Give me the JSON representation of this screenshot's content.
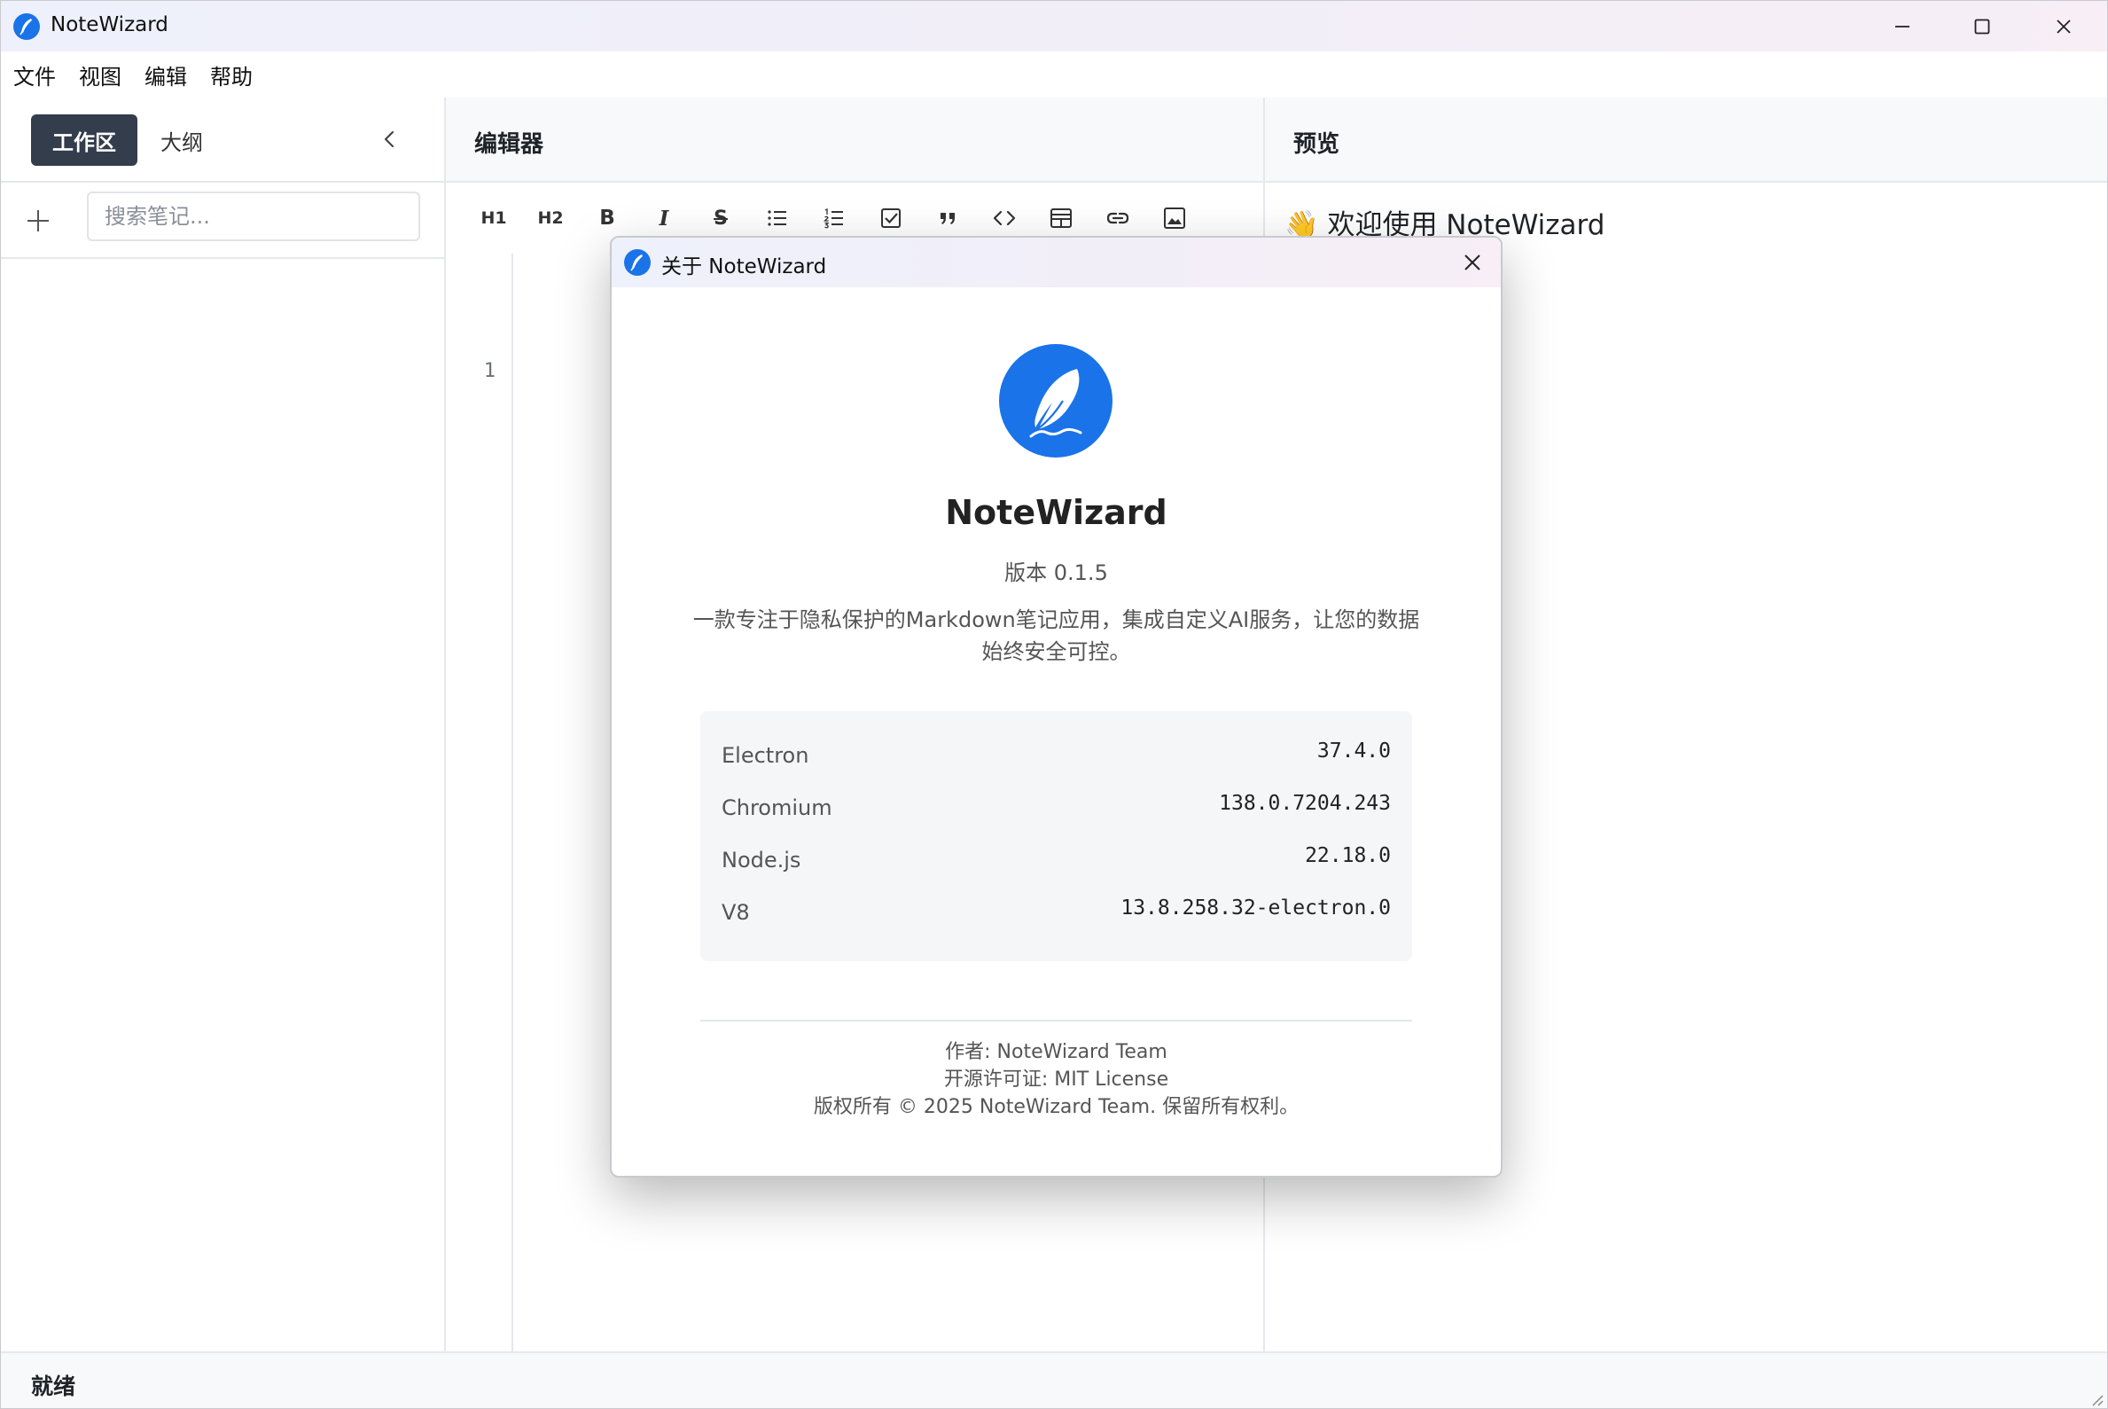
{
  "window": {
    "title": "NoteWizard",
    "controls": {
      "minimize_icon": "minimize-icon",
      "maximize_icon": "maximize-icon",
      "close_icon": "close-icon"
    }
  },
  "menu": {
    "items": [
      "文件",
      "视图",
      "编辑",
      "帮助"
    ]
  },
  "sidebar": {
    "tabs": [
      {
        "label": "工作区",
        "active": true
      },
      {
        "label": "大纲",
        "active": false
      }
    ],
    "search_placeholder": "搜索笔记..."
  },
  "editor": {
    "title": "编辑器",
    "toolbar": [
      "H1",
      "H2",
      "B",
      "I",
      "S",
      "bullet-list-icon",
      "ordered-list-icon",
      "checkbox-icon",
      "quote-icon",
      "code-icon",
      "table-icon",
      "link-icon",
      "image-icon"
    ],
    "line_numbers": [
      "1"
    ]
  },
  "preview": {
    "title": "预览",
    "heading": "👋 欢迎使用 NoteWizard"
  },
  "status": {
    "text": "就绪"
  },
  "about_dialog": {
    "title": "关于 NoteWizard",
    "app_name": "NoteWizard",
    "version": "版本 0.1.5",
    "description": "一款专注于隐私保护的Markdown笔记应用，集成自定义AI服务，让您的数据始终安全可控。",
    "versions": [
      {
        "label": "Electron",
        "value": "37.4.0"
      },
      {
        "label": "Chromium",
        "value": "138.0.7204.243"
      },
      {
        "label": "Node.js",
        "value": "22.18.0"
      },
      {
        "label": "V8",
        "value": "13.8.258.32-electron.0"
      }
    ],
    "author": "作者: NoteWizard Team",
    "license": "开源许可证: MIT License",
    "copyright": "版权所有 © 2025 NoteWizard Team. 保留所有权利。"
  },
  "colors": {
    "accent": "#1a73e8",
    "active_tab_bg": "#333d4b"
  }
}
